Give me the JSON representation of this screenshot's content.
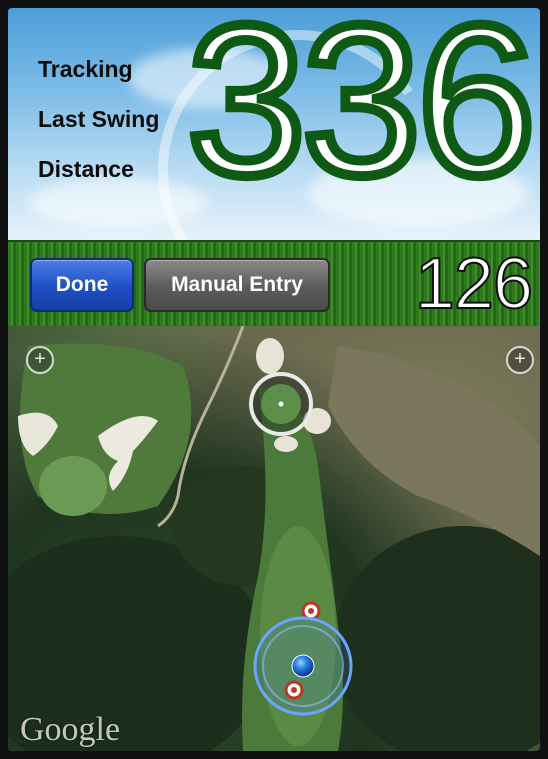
{
  "header": {
    "labels": [
      "Tracking",
      "Last Swing",
      "Distance"
    ],
    "distance_value": "336"
  },
  "toolbar": {
    "done_label": "Done",
    "manual_entry_label": "Manual Entry",
    "remaining_distance": "126"
  },
  "map": {
    "zoom_in_left": "+",
    "zoom_in_right": "+",
    "attribution": "Google"
  },
  "colors": {
    "distance_green": "#0e5a14",
    "done_blue": "#1d4fc4",
    "manual_gray": "#5c5c5c",
    "grass": "#3f8f2a"
  }
}
